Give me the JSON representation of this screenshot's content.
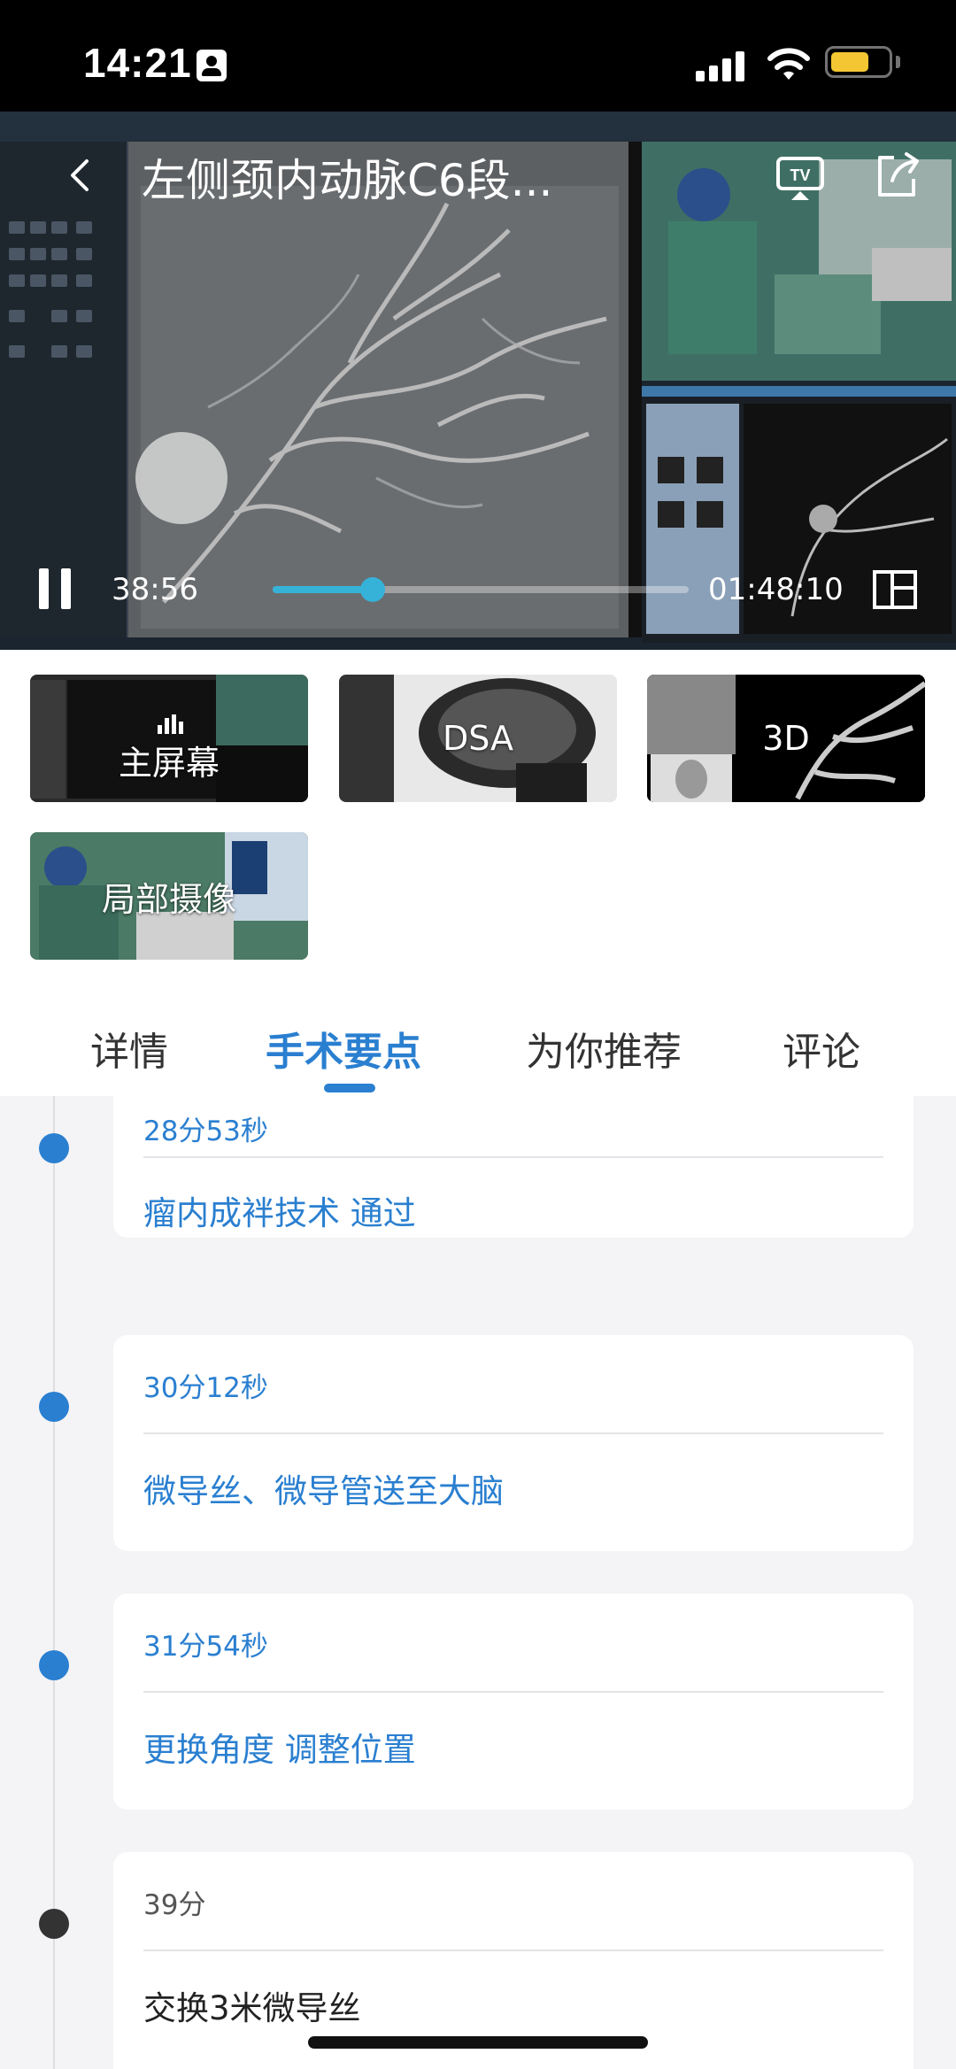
{
  "status": {
    "time": "14:21"
  },
  "player": {
    "title": "左侧颈内动脉C6段...",
    "current_time": "38:56",
    "total_time": "01:48:10",
    "progress": 0.24
  },
  "sources": [
    {
      "label": "主屏幕"
    },
    {
      "label": "DSA"
    },
    {
      "label": "3D"
    },
    {
      "label": "局部摄像"
    }
  ],
  "tabs": [
    {
      "label": "详情"
    },
    {
      "label": "手术要点"
    },
    {
      "label": "为你推荐"
    },
    {
      "label": "评论"
    }
  ],
  "timeline": [
    {
      "time": "28分53秒",
      "text": "瘤内成袢技术 通过"
    },
    {
      "time": "30分12秒",
      "text": "微导丝、微导管送至大脑"
    },
    {
      "time": "31分54秒",
      "text": "更换角度 调整位置"
    },
    {
      "time": "39分",
      "text": "交换3米微导丝"
    }
  ],
  "colors": {
    "accent": "#2a7fd0",
    "progress": "#36b2d8",
    "battery": "#f4c633"
  }
}
